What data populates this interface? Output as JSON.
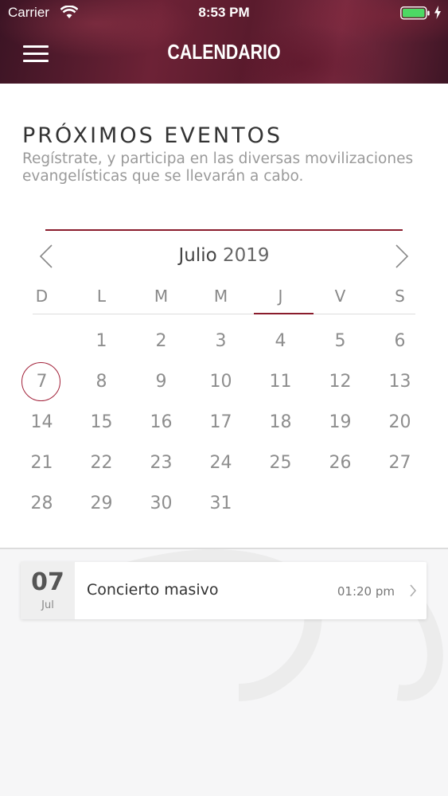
{
  "status_bar": {
    "carrier": "Carrier",
    "time": "8:53 PM"
  },
  "header": {
    "title": "CALENDARIO"
  },
  "intro": {
    "title": "PRÓXIMOS EVENTOS",
    "subtitle": "Regístrate, y participa en las diversas movilizaciones evangelísticas que se llevarán a cabo."
  },
  "calendar": {
    "month": "Julio",
    "year": "2019",
    "weekdays": [
      "D",
      "L",
      "M",
      "M",
      "J",
      "V",
      "S"
    ],
    "selected_weekday_index": 4,
    "first_day_offset": 1,
    "days_in_month": 31,
    "selected_day": 7
  },
  "events": [
    {
      "day": "07",
      "month": "Jul",
      "title": "Concierto masivo",
      "time": "01:20 pm"
    }
  ],
  "colors": {
    "accent": "#8a1c2c",
    "ring": "#a2223a"
  },
  "icons": [
    "menu-icon",
    "wifi-icon",
    "battery-icon",
    "charge-icon",
    "chevron-left-icon",
    "chevron-right-icon"
  ]
}
